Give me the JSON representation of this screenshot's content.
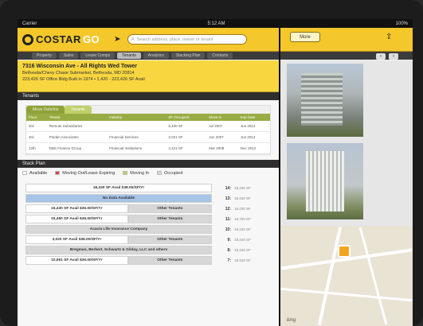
{
  "statusbar": {
    "left": "Carrier",
    "time": "5:12 AM",
    "right": "100%"
  },
  "app": {
    "logo_text": "COSTAR",
    "logo_suffix": "GO"
  },
  "search": {
    "placeholder": "Search address, place, owner or tenant"
  },
  "more_label": "More",
  "nav": {
    "tabs": [
      "Property",
      "Sales",
      "Lease Comps",
      "Tenants",
      "Analytics",
      "Stacking Plan",
      "Contacts"
    ],
    "active_index": 3
  },
  "property": {
    "title": "7316 Wisconsin Ave - All Rights Wed Tower",
    "sub1": "Bethesda/Chevy Chase Submarket, Bethesda, MD 20814",
    "sub2": "223,426 SF Office Bldg Built in 1974  •  1,420 - 223,426 SF Avail"
  },
  "tenants": {
    "header": "Tenants",
    "tabs": [
      "Move Outs/Ins",
      "Tenants"
    ],
    "columns": [
      "Floor",
      "Tenant",
      "Industry",
      "SF Occupied",
      "Move In",
      "Exp Date"
    ],
    "rows": [
      [
        "3rd",
        "Remote Subsidiaries",
        "",
        "5,100 SF",
        "Jul 2007",
        "Jun 2012"
      ],
      [
        "3rd",
        "Pinden Associates",
        "Financial Services",
        "3,021 SF",
        "Jun 2007",
        "Jun 2012"
      ],
      [
        "12th",
        "DBS Finance Group",
        "Financial Institutions",
        "4,421 SF",
        "Mar 2008",
        "Dec 2012"
      ]
    ]
  },
  "stack": {
    "header": "Stack Plan",
    "legend": [
      "Available",
      "Moving Out/Lease Expiring",
      "Moving In",
      "Occupied"
    ],
    "legend_colors": [
      "#ffffff",
      "#d9433a",
      "#c3d24a",
      "#d7d7d7"
    ],
    "floors": [
      {
        "num": "14:",
        "sf": "18,430 SF",
        "segs": [
          {
            "text": "18,430 SF Avail $38.00/SF/Yr",
            "color": "#ffffff",
            "w": 1
          }
        ]
      },
      {
        "num": "13:",
        "sf": "18,430 SF",
        "segs": [
          {
            "text": "No Data Available",
            "color": "#a7c3e6",
            "w": 1
          }
        ]
      },
      {
        "num": "12:",
        "sf": "18,430 SF",
        "segs": [
          {
            "text": "16,430 SF Avail $36.00/SF/Yr",
            "color": "#ffffff",
            "w": 0.55
          },
          {
            "text": "Other Tenants",
            "color": "#d7d7d7",
            "w": 0.45
          }
        ]
      },
      {
        "num": "11:",
        "sf": "18,750 SF",
        "segs": [
          {
            "text": "15,450 SF Avail $36.00/SF/Yr",
            "color": "#ffffff",
            "w": 0.55
          },
          {
            "text": "Other Tenants",
            "color": "#d7d7d7",
            "w": 0.45
          }
        ]
      },
      {
        "num": "10:",
        "sf": "18,430 SF",
        "segs": [
          {
            "text": "Acacia Life Insurance Company",
            "color": "#d7d7d7",
            "w": 1
          }
        ]
      },
      {
        "num": "9:",
        "sf": "18,430 SF",
        "segs": [
          {
            "text": "3,020 SF Avail $38.00/SF/Yr",
            "color": "#ffffff",
            "w": 0.55
          },
          {
            "text": "Other Tenants",
            "color": "#d7d7d7",
            "w": 0.45
          }
        ]
      },
      {
        "num": "8:",
        "sf": "18,430 SF",
        "segs": [
          {
            "text": "Bregman, Berbert, Schwartz & Gilday, LLC and others",
            "color": "#d7d7d7",
            "w": 1
          }
        ]
      },
      {
        "num": "7:",
        "sf": "18,430 SF",
        "segs": [
          {
            "text": "10,061 SF Avail $36.00/SF/Yr",
            "color": "#ffffff",
            "w": 0.55
          },
          {
            "text": "Other Tenants",
            "color": "#d7d7d7",
            "w": 0.45
          }
        ]
      }
    ]
  },
  "map": {
    "provider": "bing"
  },
  "colors": {
    "accent": "#f4c72b",
    "green": "#98ac44",
    "dark": "#2e2e2e"
  }
}
